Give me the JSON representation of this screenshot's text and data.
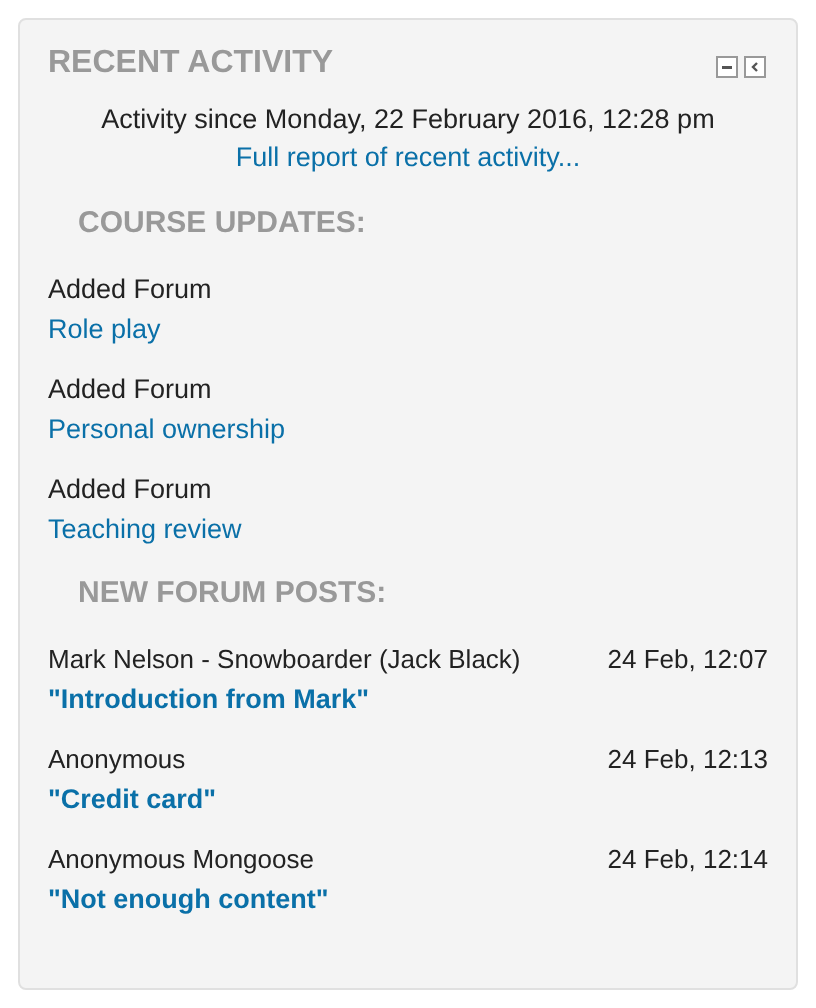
{
  "block": {
    "title": "RECENT ACTIVITY",
    "since": "Activity since Monday, 22 February 2016, 12:28 pm",
    "full_report_link": "Full report of recent activity..."
  },
  "course_updates": {
    "heading": "COURSE UPDATES:",
    "items": [
      {
        "action": "Added Forum",
        "link": "Role play"
      },
      {
        "action": "Added Forum",
        "link": "Personal ownership"
      },
      {
        "action": "Added Forum",
        "link": "Teaching review"
      }
    ]
  },
  "forum_posts": {
    "heading": "NEW FORUM POSTS:",
    "items": [
      {
        "author": "Mark Nelson - Snowboarder (Jack Black)",
        "time": "24 Feb, 12:07",
        "subject": "\"Introduction from Mark\""
      },
      {
        "author": "Anonymous",
        "time": "24 Feb, 12:13",
        "subject": "\"Credit card\""
      },
      {
        "author": "Anonymous Mongoose",
        "time": "24 Feb, 12:14",
        "subject": "\"Not enough content\""
      }
    ]
  }
}
